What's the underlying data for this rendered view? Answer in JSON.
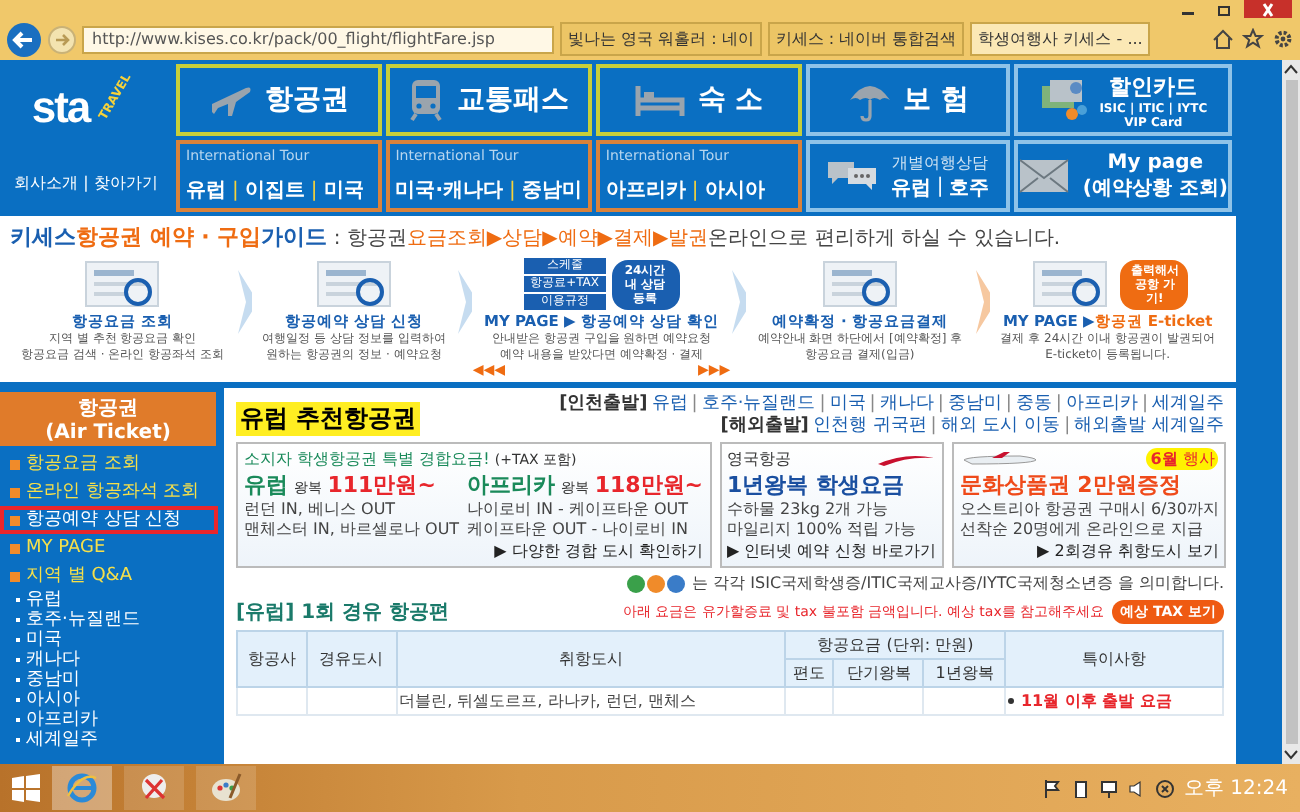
{
  "browser": {
    "address": "http://www.kises.co.kr/pack/00_flight/flightFare.jsp",
    "tabs": [
      {
        "title": "빛나는 영국 워홀러 : 네이",
        "selected": false
      },
      {
        "title": "키세스 : 네이버 통합검색",
        "selected": false
      },
      {
        "title": "학생여행사 키세스 - ...",
        "selected": true
      }
    ]
  },
  "header": {
    "logo": "sta",
    "logo_sub": "TRAVEL",
    "company_links": "회사소개 | 찾아가기",
    "top_tiles": [
      {
        "kind": "product",
        "label": "항공권"
      },
      {
        "kind": "product",
        "label": "교통패스"
      },
      {
        "kind": "product",
        "label": "숙 소"
      },
      {
        "kind": "service",
        "label": "보 험"
      },
      {
        "kind": "card",
        "label": "할인카드",
        "sub": [
          "ISIC | ITIC | IYTC",
          "VIP Card"
        ]
      }
    ],
    "bottom_tiles": [
      {
        "kind": "tour",
        "caption": "International Tour",
        "links": [
          "유럽",
          "이집트",
          "미국"
        ]
      },
      {
        "kind": "tour",
        "caption": "International Tour",
        "links": [
          "미국·캐나다",
          "중남미"
        ]
      },
      {
        "kind": "tour",
        "caption": "International Tour",
        "links": [
          "아프리카",
          "아시아"
        ]
      },
      {
        "kind": "consult",
        "caption": "개별여행상담",
        "links": [
          "유럽",
          "호주"
        ]
      },
      {
        "kind": "mypage",
        "label": "My page",
        "sub": "(예약상황 조회)"
      }
    ],
    "separator": "|"
  },
  "guide": {
    "title": [
      {
        "kind": "brand",
        "text": "키세스"
      },
      {
        "kind": "accent",
        "text": "항공권 예약 · 구입"
      },
      {
        "kind": "brand",
        "text": "가이드"
      }
    ],
    "subtitle": [
      {
        "kind": "plain",
        "text": ": 항공권"
      },
      {
        "kind": "accent",
        "text": "요금조회▶상담▶예약▶결제▶발권"
      },
      {
        "kind": "plain",
        "text": "온라인으로 편리하게 하실 수 있습니다."
      }
    ],
    "steps": [
      {
        "title": [
          {
            "kind": "brand",
            "text": "항공요금 조회"
          }
        ],
        "desc": [
          "지역 별 추천 항공요금 확인",
          "항공요금 검색 · 온라인 항공좌석 조회"
        ]
      },
      {
        "title": [
          {
            "kind": "brand",
            "text": "항공예약 상담 신청"
          }
        ],
        "desc": [
          "여행일정 등 상담 정보를 입력하여",
          "원하는 항공권의 정보 · 예약요청"
        ]
      },
      {
        "title": [
          {
            "kind": "brand",
            "text": "MY PAGE ▶ 항공예약 상담 확인"
          }
        ],
        "desc": [
          "안내받은 항공권 구입을 원하면 예약요청",
          "예약 내용을 받았다면 예약확정 · 결제"
        ],
        "prev_arrows": "◀◀◀",
        "next_arrows": "▶▶▶",
        "labels": [
          "스케줄",
          "항공료+TAX",
          "이용규정"
        ],
        "bubble": "24시간 내 상담 등록"
      },
      {
        "title": [
          {
            "kind": "brand",
            "text": "예약확정 · 항공요금결제"
          }
        ],
        "desc": [
          "예약안내 화면 하단에서 [예약확정] 후",
          "항공요금 결제(입금)"
        ]
      },
      {
        "title": [
          {
            "kind": "brand",
            "text": "MY PAGE ▶"
          },
          {
            "kind": "accent",
            "text": "항공권 E-ticket"
          }
        ],
        "desc": [
          "결제 후 24시간 이내 항공권이 발권되어",
          "E-ticket이 등록됩니다."
        ],
        "bubble": "출력해서 공항 가기!"
      }
    ]
  },
  "sidebar": {
    "heading": "항공권",
    "heading_sub": "(Air Ticket)",
    "items": [
      {
        "label": "항공요금 조회",
        "selected": false
      },
      {
        "label": "온라인 항공좌석 조회",
        "selected": false
      },
      {
        "label": "항공예약 상담 신청",
        "selected": true
      },
      {
        "label": "MY PAGE",
        "selected": false
      },
      {
        "label": "지역 별 Q&A",
        "selected": false,
        "children": [
          {
            "label": "유럽"
          },
          {
            "label": "호주·뉴질랜드"
          },
          {
            "label": "미국"
          },
          {
            "label": "캐나다"
          },
          {
            "label": "중남미"
          },
          {
            "label": "아시아"
          },
          {
            "label": "아프리카"
          },
          {
            "label": "세계일주"
          }
        ]
      }
    ]
  },
  "main": {
    "title": "유럽 추천항공권",
    "departures": [
      {
        "label": "[인천출발]",
        "links": [
          "유럽",
          "호주·뉴질랜드",
          "미국",
          "캐나다",
          "중남미",
          "중동",
          "아프리카",
          "세계일주"
        ]
      },
      {
        "label": "[해외출발]",
        "links": [
          "인천행 귀국편",
          "해외 도시 이동",
          "해외출발 세계일주"
        ]
      }
    ],
    "banners": [
      {
        "kind": "fare",
        "caption": "소지자 학생항공권 특별 경합요금!",
        "caption_note": "(+TAX 포함)",
        "offers": [
          {
            "region": "유럽",
            "trip": "왕복",
            "price": "111만원~",
            "routes": [
              "런던 IN, 베니스 OUT",
              "맨체스터 IN, 바르셀로나 OUT"
            ]
          },
          {
            "region": "아프리카",
            "trip": "왕복",
            "price": "118만원~",
            "routes": [
              "나이로비 IN - 케이프타운 OUT",
              "케이프타운 OUT - 나이로비 IN"
            ]
          }
        ],
        "link": "▶ 다양한 경합 도시 확인하기"
      },
      {
        "kind": "airline",
        "caption": "영국항공",
        "headline": "1년왕복 학생요금",
        "lines": [
          "수하물 23kg 2개 가능",
          "마일리지 100% 적립 가능"
        ],
        "link": "▶ 인터넷 예약 신청 바로가기"
      },
      {
        "kind": "event",
        "badge_month": "6월",
        "badge": "행사",
        "headline": "문화상품권 2만원증정",
        "lines": [
          "오스트리아 항공권 구매시 6/30까지",
          "선착순 20명에게 온라인으로 지급"
        ],
        "link": "▶ 2회경유 취항도시 보기"
      }
    ],
    "legend": "는 각각 ISIC국제학생증/ITIC국제교사증/IYTC국제청소년증 을 의미합니다.",
    "section": {
      "title": "[유럽] 1회 경유 항공편",
      "note": "아래 요금은 유가할증료 및 tax 불포함 금액입니다. 예상 tax를 참고해주세요",
      "button": "예상 TAX 보기"
    },
    "table": {
      "columns": [
        {
          "label": "항공사"
        },
        {
          "label": "경유도시"
        },
        {
          "label": "취항도시"
        },
        {
          "label": "항공요금 (단위: 만원)",
          "children": [
            {
              "label": "편도"
            },
            {
              "label": "단기왕복"
            },
            {
              "label": "1년왕복"
            }
          ]
        },
        {
          "label": "특이사항"
        }
      ],
      "rows": [
        {
          "destinations": "더블린, 뒤셀도르프, 라나카, 런던, 맨체스",
          "notes": [
            "11월 이후 출발 요금"
          ]
        }
      ]
    }
  },
  "taskbar": {
    "clock": "오후 12:24"
  }
}
